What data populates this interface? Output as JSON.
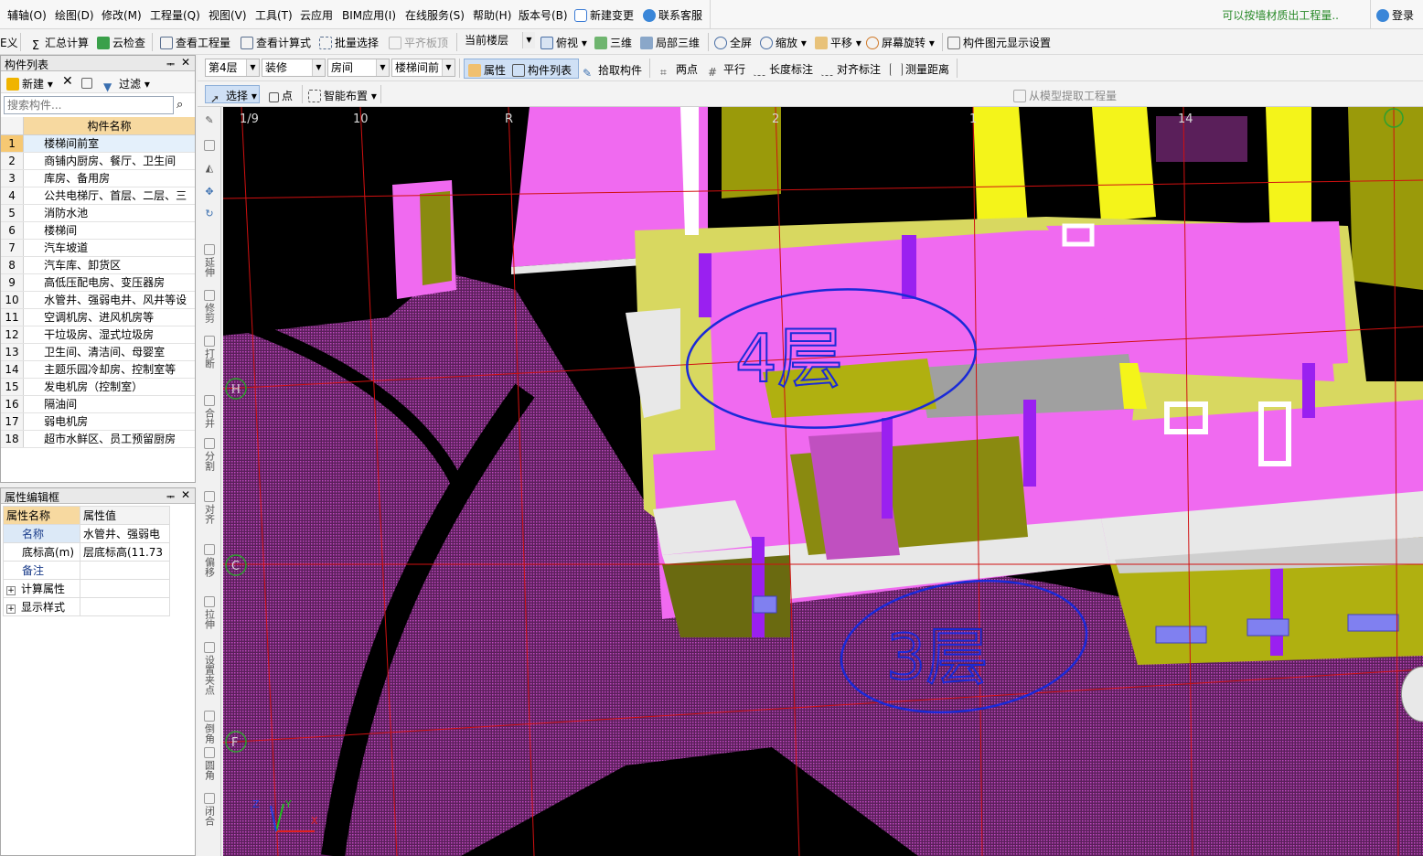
{
  "menubar": {
    "items": [
      "辅轴(O)",
      "绘图(D)",
      "修改(M)",
      "工程量(Q)",
      "视图(V)",
      "工具(T)",
      "云应用",
      "BIM应用(I)",
      "在线服务(S)",
      "帮助(H)",
      "版本号(B)"
    ],
    "new_change": "新建变更",
    "contact": "联系客服",
    "promo": "可以按墙材质出工程量..",
    "login": "登录"
  },
  "toolbar1": {
    "cut_label": "E义",
    "summary": "汇总计算",
    "cloud_check": "云检查",
    "view_qty": "查看工程量",
    "view_formula": "查看计算式",
    "batch_select": "批量选择",
    "flush_slab": "平齐板顶",
    "floor_select": "当前楼层",
    "top_view": "俯视",
    "three_d": "三维",
    "local_3d": "局部三维",
    "fullscreen": "全屏",
    "zoom": "缩放",
    "pan": "平移",
    "rotate": "屏幕旋转",
    "display_settings": "构件图元显示设置"
  },
  "toolbar2": {
    "floor": "第4层",
    "category": "装修",
    "type": "房间",
    "component": "楼梯间前",
    "properties": "属性",
    "component_list": "构件列表",
    "pick": "拾取构件",
    "two_points": "两点",
    "parallel": "平行",
    "length_dim": "长度标注",
    "align_dim": "对齐标注",
    "measure": "测量距离"
  },
  "toolbar3": {
    "select": "选择",
    "point": "点",
    "smart_layout": "智能布置",
    "extract": "从模型提取工程量"
  },
  "component_panel": {
    "title": "构件列表",
    "new": "新建",
    "filter": "过滤",
    "search_placeholder": "搜索构件...",
    "column_header": "构件名称",
    "rows": [
      {
        "num": "1",
        "name": "楼梯间前室"
      },
      {
        "num": "2",
        "name": "商铺内厨房、餐厅、卫生间"
      },
      {
        "num": "3",
        "name": "库房、备用房"
      },
      {
        "num": "4",
        "name": "公共电梯厅、首层、二层、三"
      },
      {
        "num": "5",
        "name": "消防水池"
      },
      {
        "num": "6",
        "name": "楼梯间"
      },
      {
        "num": "7",
        "name": "汽车坡道"
      },
      {
        "num": "8",
        "name": "汽车库、卸货区"
      },
      {
        "num": "9",
        "name": "高低压配电房、变压器房"
      },
      {
        "num": "10",
        "name": "水管井、强弱电井、风井等设"
      },
      {
        "num": "11",
        "name": "空调机房、进风机房等"
      },
      {
        "num": "12",
        "name": "干垃圾房、湿式垃圾房"
      },
      {
        "num": "13",
        "name": "卫生间、清洁间、母婴室"
      },
      {
        "num": "14",
        "name": "主题乐园冷却房、控制室等"
      },
      {
        "num": "15",
        "name": "发电机房（控制室）"
      },
      {
        "num": "16",
        "name": "隔油间"
      },
      {
        "num": "17",
        "name": "弱电机房"
      },
      {
        "num": "18",
        "name": "超市水鲜区、员工预留厨房"
      }
    ]
  },
  "property_panel": {
    "title": "属性编辑框",
    "col_name": "属性名称",
    "col_value": "属性值",
    "rows": [
      {
        "name": "名称",
        "value": "水管井、强弱电"
      },
      {
        "name": "底标高(m)",
        "value": "层底标高(11.73"
      },
      {
        "name": "备注",
        "value": ""
      },
      {
        "name": "计算属性",
        "value": ""
      },
      {
        "name": "显示样式",
        "value": ""
      }
    ]
  },
  "side_tools": [
    "延伸",
    "修剪",
    "打断",
    "合并",
    "分割",
    "对齐",
    "偏移",
    "拉伸",
    "设置夹点",
    "倒角",
    "圆角",
    "闭合"
  ],
  "viewport": {
    "grid_labels": [
      "1/9",
      "10",
      "R",
      "2",
      "1",
      "14",
      "H",
      "C",
      "F"
    ],
    "annotation_top": "4层",
    "annotation_bottom": "3层",
    "axis_x": "X",
    "axis_y": "Y",
    "axis_z": "Z"
  }
}
